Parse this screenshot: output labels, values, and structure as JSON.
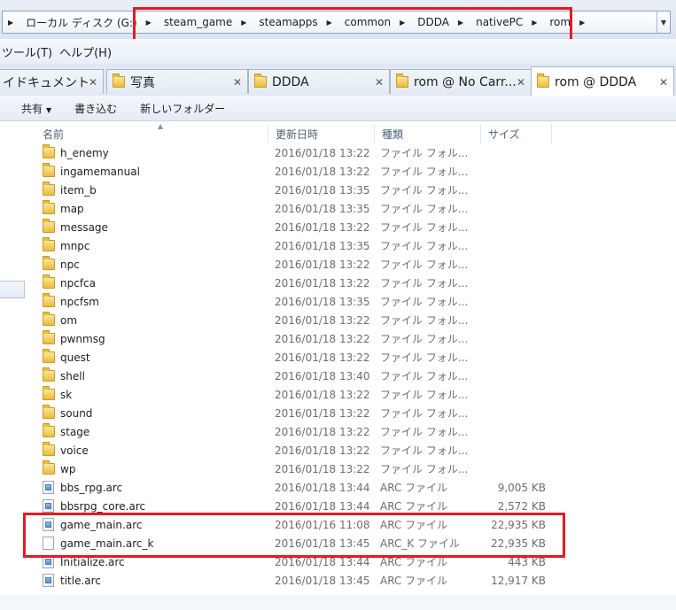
{
  "address_bar": {
    "crumbs": [
      "ローカル ディスク (G:)",
      "steam_game",
      "steamapps",
      "common",
      "DDDA",
      "nativePC",
      "rom"
    ]
  },
  "menu": {
    "items": [
      "ツール(T)",
      "ヘルプ(H)"
    ]
  },
  "tabs": [
    {
      "label": "イドキュメント",
      "active": false
    },
    {
      "label": "写真",
      "active": false
    },
    {
      "label": "DDDA",
      "active": false
    },
    {
      "label": "rom  @ No Carr...",
      "active": false
    },
    {
      "label": "rom  @ DDDA",
      "active": true
    }
  ],
  "toolbar": {
    "share_label": "共有",
    "burn_label": "書き込む",
    "new_folder_label": "新しいフォルダー"
  },
  "columns": {
    "name": "名前",
    "date": "更新日時",
    "type": "種類",
    "size": "サイズ"
  },
  "files": [
    {
      "name": "h_enemy",
      "date": "2016/01/18 13:22",
      "type": "ファイル フォル...",
      "size": "",
      "icon": "folder-icon"
    },
    {
      "name": "ingamemanual",
      "date": "2016/01/18 13:22",
      "type": "ファイル フォル...",
      "size": "",
      "icon": "folder-icon"
    },
    {
      "name": "item_b",
      "date": "2016/01/18 13:35",
      "type": "ファイル フォル...",
      "size": "",
      "icon": "folder-icon"
    },
    {
      "name": "map",
      "date": "2016/01/18 13:35",
      "type": "ファイル フォル...",
      "size": "",
      "icon": "folder-icon"
    },
    {
      "name": "message",
      "date": "2016/01/18 13:22",
      "type": "ファイル フォル...",
      "size": "",
      "icon": "folder-icon"
    },
    {
      "name": "mnpc",
      "date": "2016/01/18 13:35",
      "type": "ファイル フォル...",
      "size": "",
      "icon": "folder-icon"
    },
    {
      "name": "npc",
      "date": "2016/01/18 13:22",
      "type": "ファイル フォル...",
      "size": "",
      "icon": "folder-icon"
    },
    {
      "name": "npcfca",
      "date": "2016/01/18 13:22",
      "type": "ファイル フォル...",
      "size": "",
      "icon": "folder-icon"
    },
    {
      "name": "npcfsm",
      "date": "2016/01/18 13:35",
      "type": "ファイル フォル...",
      "size": "",
      "icon": "folder-icon"
    },
    {
      "name": "om",
      "date": "2016/01/18 13:22",
      "type": "ファイル フォル...",
      "size": "",
      "icon": "folder-icon"
    },
    {
      "name": "pwnmsg",
      "date": "2016/01/18 13:22",
      "type": "ファイル フォル...",
      "size": "",
      "icon": "folder-icon"
    },
    {
      "name": "quest",
      "date": "2016/01/18 13:22",
      "type": "ファイル フォル...",
      "size": "",
      "icon": "folder-icon"
    },
    {
      "name": "shell",
      "date": "2016/01/18 13:40",
      "type": "ファイル フォル...",
      "size": "",
      "icon": "folder-icon"
    },
    {
      "name": "sk",
      "date": "2016/01/18 13:22",
      "type": "ファイル フォル...",
      "size": "",
      "icon": "folder-icon"
    },
    {
      "name": "sound",
      "date": "2016/01/18 13:22",
      "type": "ファイル フォル...",
      "size": "",
      "icon": "folder-icon"
    },
    {
      "name": "stage",
      "date": "2016/01/18 13:22",
      "type": "ファイル フォル...",
      "size": "",
      "icon": "folder-icon"
    },
    {
      "name": "voice",
      "date": "2016/01/18 13:22",
      "type": "ファイル フォル...",
      "size": "",
      "icon": "folder-icon"
    },
    {
      "name": "wp",
      "date": "2016/01/18 13:22",
      "type": "ファイル フォル...",
      "size": "",
      "icon": "folder-icon"
    },
    {
      "name": "bbs_rpg.arc",
      "date": "2016/01/18 13:44",
      "type": "ARC ファイル",
      "size": "9,005 KB",
      "icon": "arc-file-icon"
    },
    {
      "name": "bbsrpg_core.arc",
      "date": "2016/01/18 13:44",
      "type": "ARC ファイル",
      "size": "2,572 KB",
      "icon": "arc-file-icon"
    },
    {
      "name": "game_main.arc",
      "date": "2016/01/16 11:08",
      "type": "ARC ファイル",
      "size": "22,935 KB",
      "icon": "arc-file-icon"
    },
    {
      "name": "game_main.arc_k",
      "date": "2016/01/18 13:45",
      "type": "ARC_K ファイル",
      "size": "22,935 KB",
      "icon": "file-icon"
    },
    {
      "name": "Initialize.arc",
      "date": "2016/01/18 13:44",
      "type": "ARC ファイル",
      "size": "443 KB",
      "icon": "arc-file-icon"
    },
    {
      "name": "title.arc",
      "date": "2016/01/18 13:45",
      "type": "ARC ファイル",
      "size": "12,917 KB",
      "icon": "arc-file-icon"
    }
  ],
  "highlight_color": "#e41a24"
}
